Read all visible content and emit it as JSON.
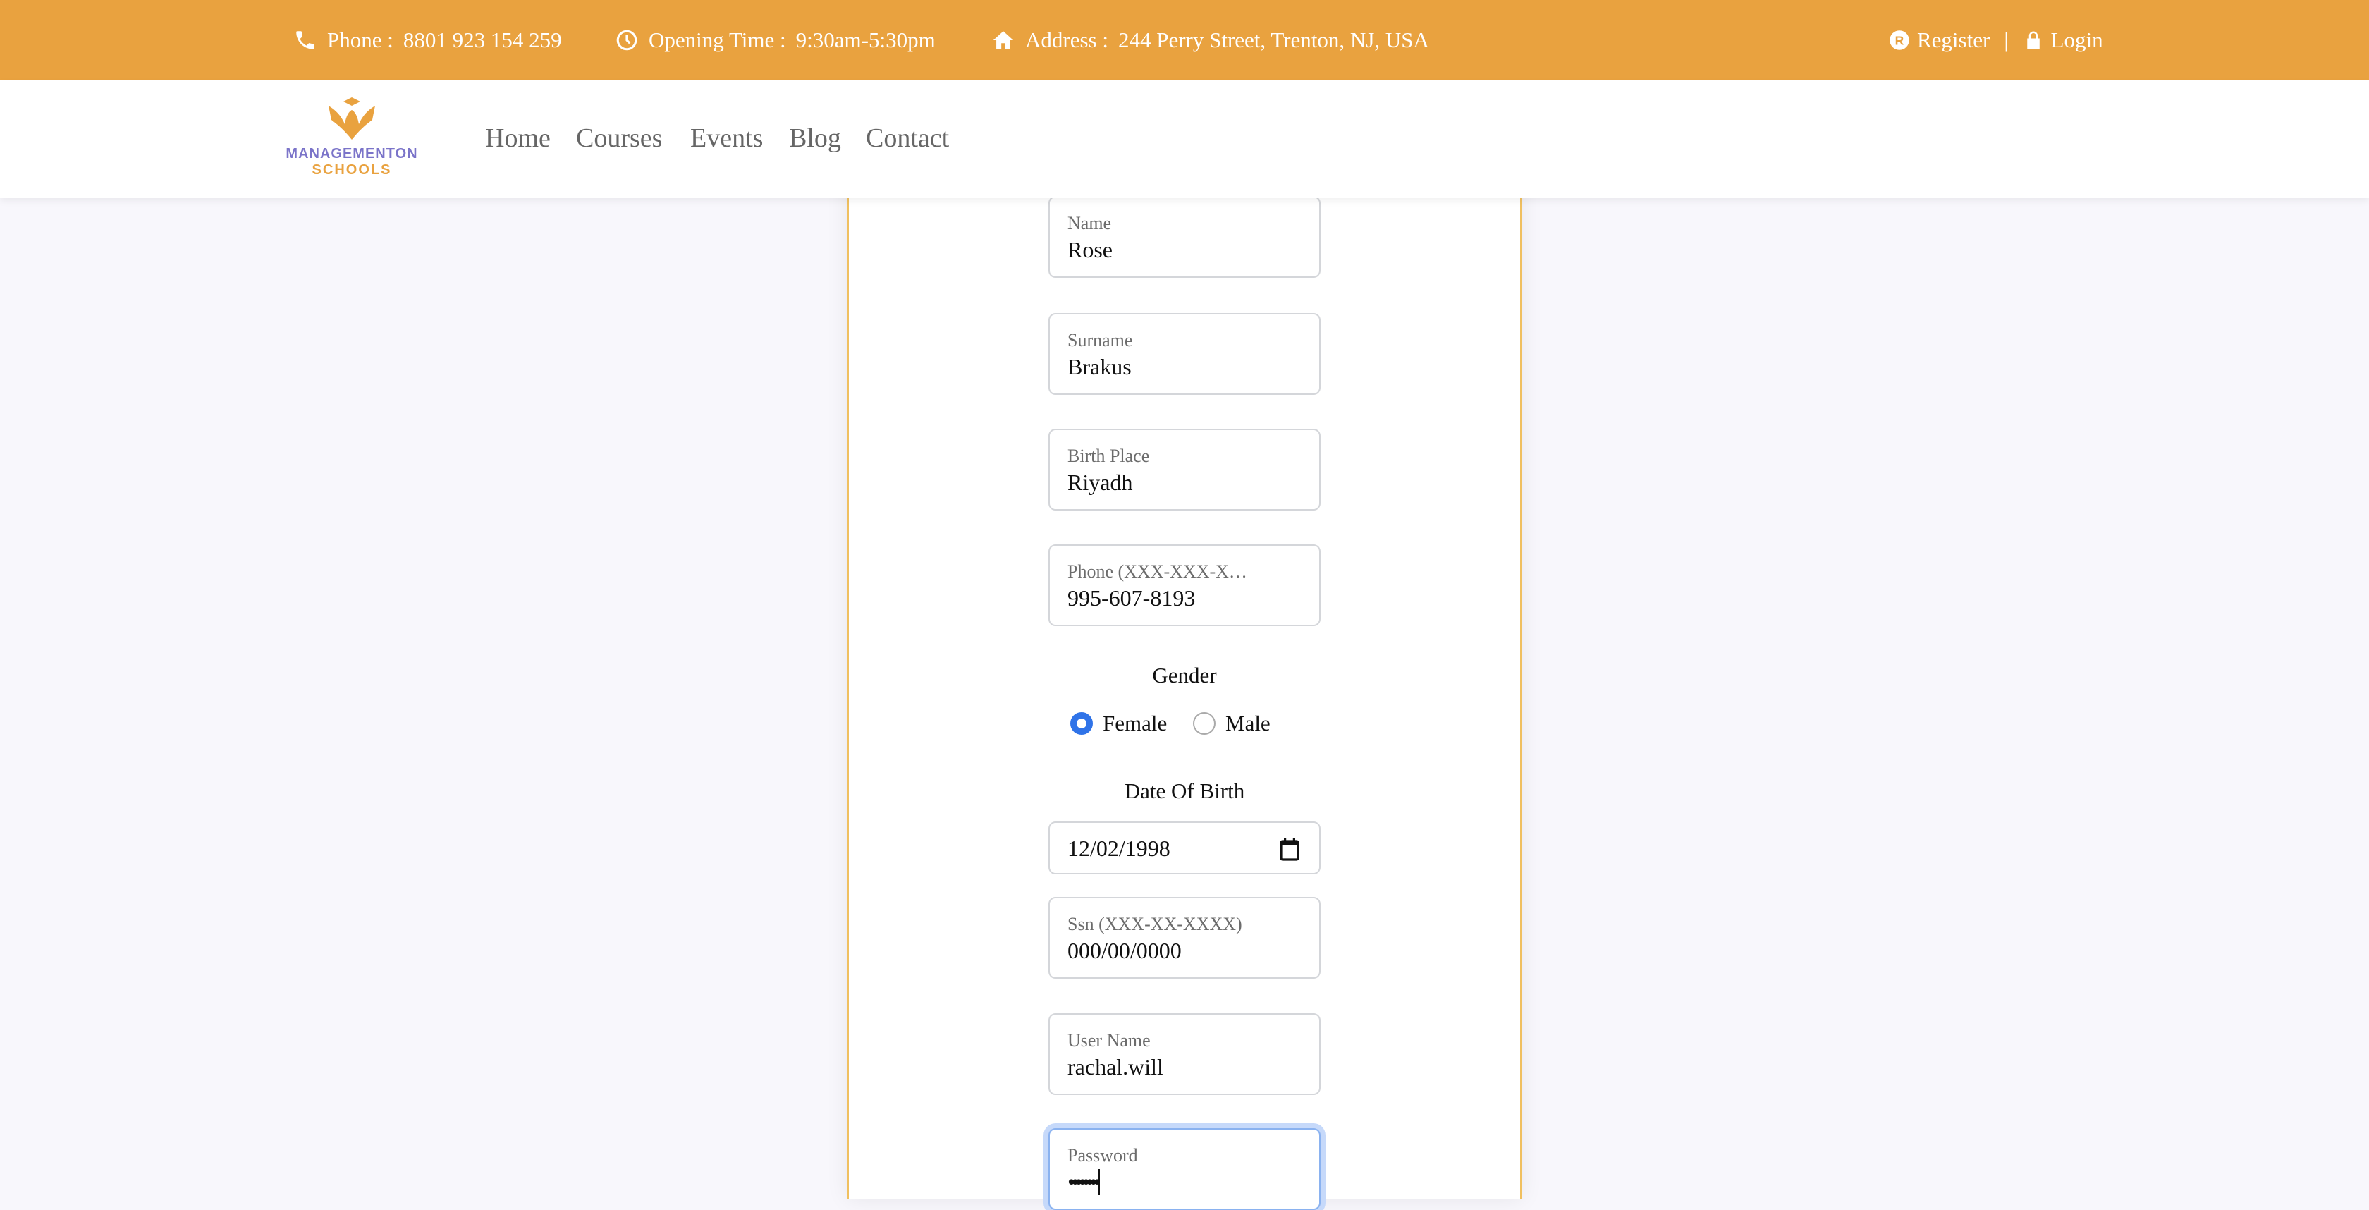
{
  "topbar": {
    "phone_label": "Phone :",
    "phone": "8801 923 154 259",
    "hours_label": "Opening Time :",
    "hours": "9:30am-5:30pm",
    "address_label": "Address :",
    "address": "244 Perry Street, Trenton, NJ, USA",
    "register": "Register",
    "separator": "|",
    "login": "Login"
  },
  "logo": {
    "line1": "MANAGEMENTON",
    "line2": "SCHOOLS"
  },
  "nav": [
    "Home",
    "Courses",
    "Events",
    "Blog",
    "Contact"
  ],
  "form": {
    "name": {
      "label": "Name",
      "value": "Rose"
    },
    "surname": {
      "label": "Surname",
      "value": "Brakus"
    },
    "birth_place": {
      "label": "Birth Place",
      "value": "Riyadh"
    },
    "phone": {
      "label": "Phone (XXX-XXX-XXXX)",
      "value": "995-607-8193"
    },
    "gender": {
      "label": "Gender",
      "options": [
        "Female",
        "Male"
      ],
      "selected": "Female"
    },
    "dob": {
      "label": "Date Of Birth",
      "value": "12/02/1998"
    },
    "ssn": {
      "label": "Ssn (XXX-XX-XXXX)",
      "value": "000/00/0000"
    },
    "username": {
      "label": "User Name",
      "value": "rachal.will"
    },
    "password": {
      "label": "Password",
      "value": "••••••••"
    }
  },
  "colors": {
    "accent": "#e9a23f",
    "brand_purple": "#7b74c9",
    "radio": "#2f73e8"
  }
}
